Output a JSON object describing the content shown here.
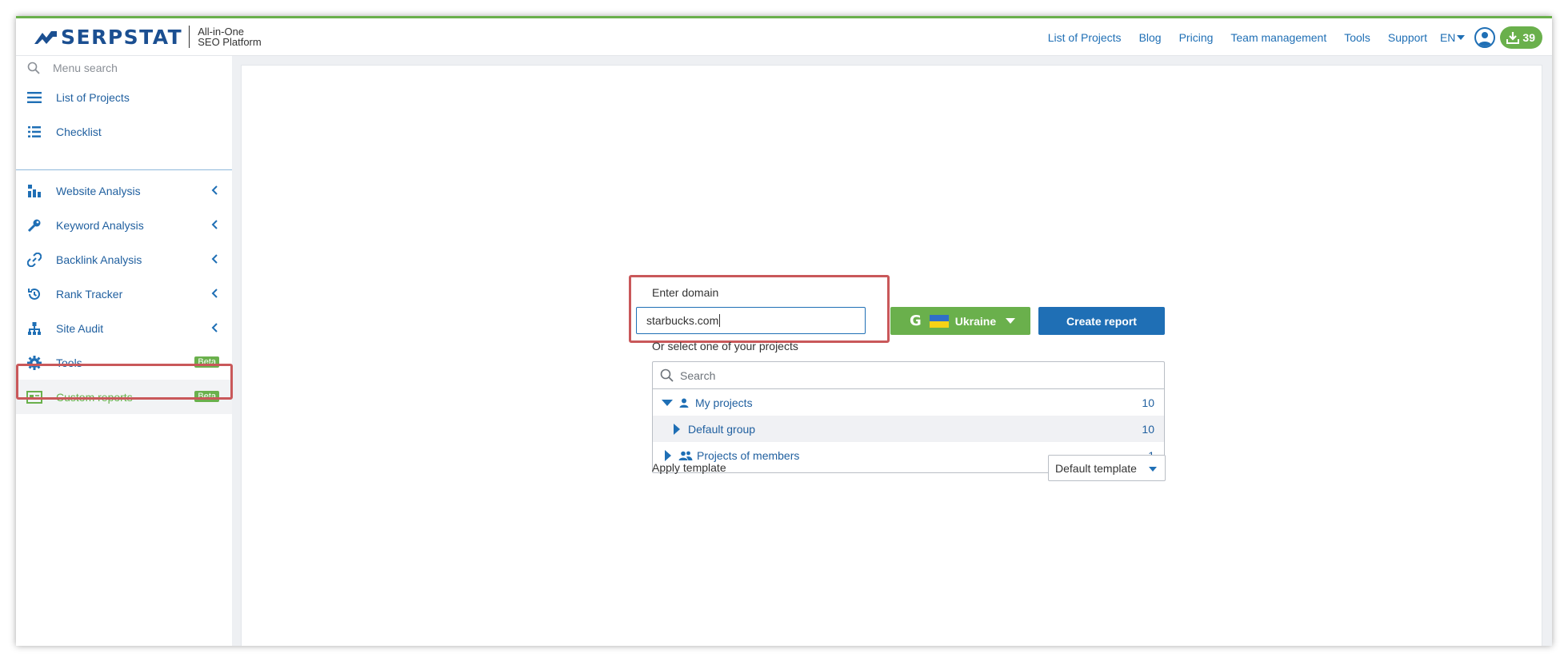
{
  "brand": {
    "name": "SERPSTAT",
    "tagline_line1": "All-in-One",
    "tagline_line2": "SEO Platform"
  },
  "header": {
    "nav": [
      "List of Projects",
      "Blog",
      "Pricing",
      "Team management",
      "Tools",
      "Support"
    ],
    "language": "EN",
    "downloads_count": "39"
  },
  "sidebar": {
    "search_placeholder": "Menu search",
    "items": [
      {
        "label": "List of Projects",
        "icon": "list-icon"
      },
      {
        "label": "Checklist",
        "icon": "checklist-icon"
      },
      {
        "label": "Website Analysis",
        "icon": "website-analysis-icon"
      },
      {
        "label": "Keyword Analysis",
        "icon": "key-icon"
      },
      {
        "label": "Backlink Analysis",
        "icon": "link-icon"
      },
      {
        "label": "Rank Tracker",
        "icon": "history-icon"
      },
      {
        "label": "Site Audit",
        "icon": "sitemap-icon"
      },
      {
        "label": "Tools",
        "icon": "gear-icon",
        "badge": "Beta"
      },
      {
        "label": "Custom reports",
        "icon": "report-icon",
        "badge": "Beta",
        "active": true
      }
    ]
  },
  "form": {
    "domain_label": "Enter domain",
    "domain_value": "starbucks.com",
    "search_engine": "Ukraine",
    "create_button": "Create report",
    "select_project_label": "Or select one of your projects",
    "project_search_placeholder": "Search",
    "projects": [
      {
        "label": "My projects",
        "count": "10"
      },
      {
        "label": "Default group",
        "count": "10"
      },
      {
        "label": "Projects of members",
        "count": "1"
      }
    ],
    "template_label": "Apply template",
    "template_value": "Default template"
  },
  "colors": {
    "accent_blue": "#1f6fb5",
    "accent_green": "#6ab04c",
    "highlight_red": "#c9585a"
  }
}
